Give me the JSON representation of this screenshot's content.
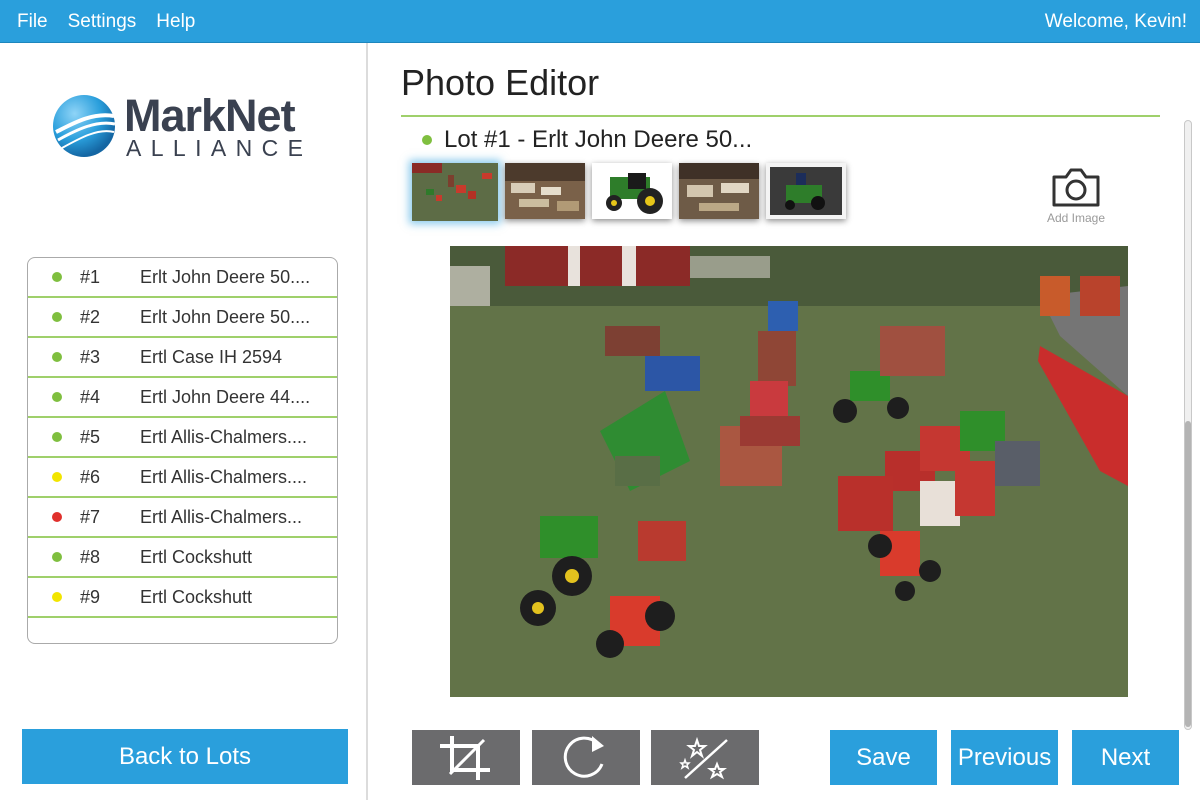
{
  "menu": {
    "file": "File",
    "settings": "Settings",
    "help": "Help"
  },
  "user": {
    "welcome": "Welcome, Kevin!"
  },
  "brand": {
    "name": "MarkNet",
    "sub": "ALLIANCE"
  },
  "colors": {
    "accent": "#2a9fdc",
    "divider": "#9fd06b",
    "status_green": "#7fbf3f",
    "status_yellow": "#f2e500",
    "status_red": "#e0302c",
    "tool_bg": "#6b6b6d"
  },
  "lots": [
    {
      "num": "#1",
      "name": "Erlt John Deere 50....",
      "status": "green"
    },
    {
      "num": "#2",
      "name": "Erlt John Deere 50....",
      "status": "green"
    },
    {
      "num": "#3",
      "name": "Ertl Case IH 2594",
      "status": "green"
    },
    {
      "num": "#4",
      "name": "Ertl John Deere 44....",
      "status": "green"
    },
    {
      "num": "#5",
      "name": "Ertl Allis-Chalmers....",
      "status": "green"
    },
    {
      "num": "#6",
      "name": "Ertl Allis-Chalmers....",
      "status": "yellow"
    },
    {
      "num": "#7",
      "name": "Ertl Allis-Chalmers...",
      "status": "red"
    },
    {
      "num": "#8",
      "name": "Ertl Cockshutt",
      "status": "green"
    },
    {
      "num": "#9",
      "name": "Ertl Cockshutt",
      "status": "yellow"
    }
  ],
  "sidebar": {
    "back_label": "Back to Lots"
  },
  "editor": {
    "title": "Photo Editor",
    "lot_heading": "Lot #1 - Erlt John Deere 50...",
    "add_image_label": "Add Image",
    "thumbnail_count": 5,
    "selected_thumbnail": 1,
    "tools": [
      "crop-icon",
      "rotate-icon",
      "magic-wand-icon"
    ],
    "save_label": "Save",
    "previous_label": "Previous",
    "next_label": "Next"
  }
}
